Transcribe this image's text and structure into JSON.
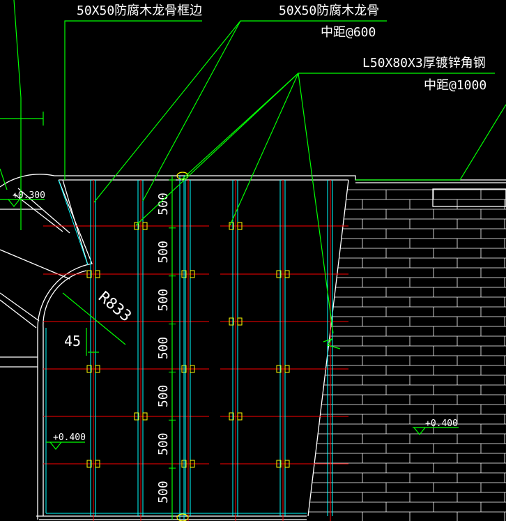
{
  "colors": {
    "background": "#000000",
    "leader": "#00ff00",
    "outline": "#ffffff",
    "joist": "#00ffff",
    "grid": "#ff0000",
    "bracket": "#ffff00",
    "brick": "#ffffff"
  },
  "annotations": {
    "frame_label": "50X50防腐木龙骨框边",
    "joist_label": "50X50防腐木龙骨",
    "joist_spacing": "中距@600",
    "angle_label": "L50X80X3厚镀锌角钢",
    "angle_spacing": "中距@1000"
  },
  "levels": {
    "upper_left": "+0.300",
    "lower_left": "+0.400",
    "right": "+0.400"
  },
  "dimensions": {
    "radius": "R833",
    "angle": "45",
    "spacings": [
      "500",
      "500",
      "500",
      "500",
      "500",
      "500",
      "500"
    ]
  },
  "icons": {
    "level_marker": "level-triangle-icon",
    "bracket": "steel-bracket-icon"
  }
}
